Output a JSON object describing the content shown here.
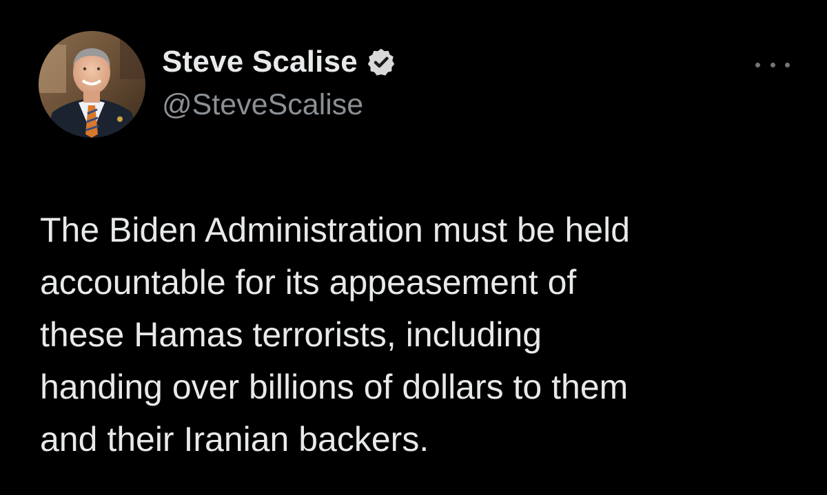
{
  "author": {
    "display_name": "Steve Scalise",
    "handle": "@SteveScalise",
    "verified": true,
    "avatar": "profile-photo-man-in-suit"
  },
  "menu": {
    "icon": "more-options-icon"
  },
  "tweet": {
    "lines": [
      "The Biden Administration must be held",
      "accountable for its appeasement of",
      "these Hamas terrorists, including",
      "handing over billions of dollars to them",
      "and their Iranian backers."
    ]
  },
  "colors": {
    "background": "#000000",
    "primary_text": "#e7e9ea",
    "secondary_text": "#8b9095",
    "badge_fill": "#d9d9d9",
    "badge_check": "#1a1a1a"
  }
}
